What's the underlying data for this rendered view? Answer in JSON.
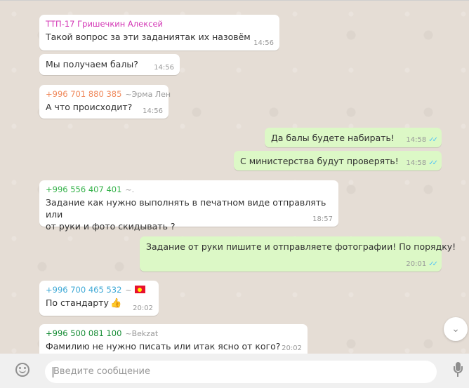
{
  "messages": [
    {
      "sender": "ТТП-17 Гришечкин Алексей",
      "sender_color": "#d336b5",
      "text": "Такой вопрос за эти заданиятак их назовём",
      "time": "14:56"
    },
    {
      "text": "Мы получаем балы?",
      "time": "14:56"
    },
    {
      "sender": "+996 701 880 385",
      "alias": "~Эрма Лен",
      "sender_color": "#f08a5d",
      "text": "А что происходит?",
      "time": "14:56"
    },
    {
      "text": "Да балы будете набирать!",
      "time": "14:58",
      "status": "read"
    },
    {
      "text": "С министерства будут проверять!",
      "time": "14:58",
      "status": "read"
    },
    {
      "sender": "+996 556 407 401",
      "alias": "~.",
      "sender_color": "#35b24a",
      "lines": [
        "Задание как нужно выполнять в печатном виде отправлять или",
        "от руки и фото скидывать ?"
      ],
      "time": "18:57"
    },
    {
      "text": "Задание от руки пишите и отправляете фотографии! По порядку!",
      "time": "20:01",
      "status": "read"
    },
    {
      "sender": "+996 700 465 532",
      "alias": "~",
      "sender_color": "#3fa9d6",
      "text": "По стандарту",
      "time": "20:02",
      "emoji": "thumbs-up"
    },
    {
      "sender": "+996 500 081 100",
      "alias": "~Bekzat",
      "sender_color": "#158c34",
      "text": "Фамилию не нужно писать или итак ясно от кого?",
      "time": "20:02"
    }
  ],
  "composer": {
    "placeholder": "Введите сообщение"
  },
  "icons": {
    "emoji": "smiley-icon",
    "mic": "microphone-icon",
    "scroll": "chevron-down-icon",
    "read": "double-check-icon"
  },
  "colors": {
    "incoming": "#ffffff",
    "outgoing": "#dcf8c6",
    "read_ticks": "#4fc3f7",
    "background": "#e5ddd5"
  }
}
